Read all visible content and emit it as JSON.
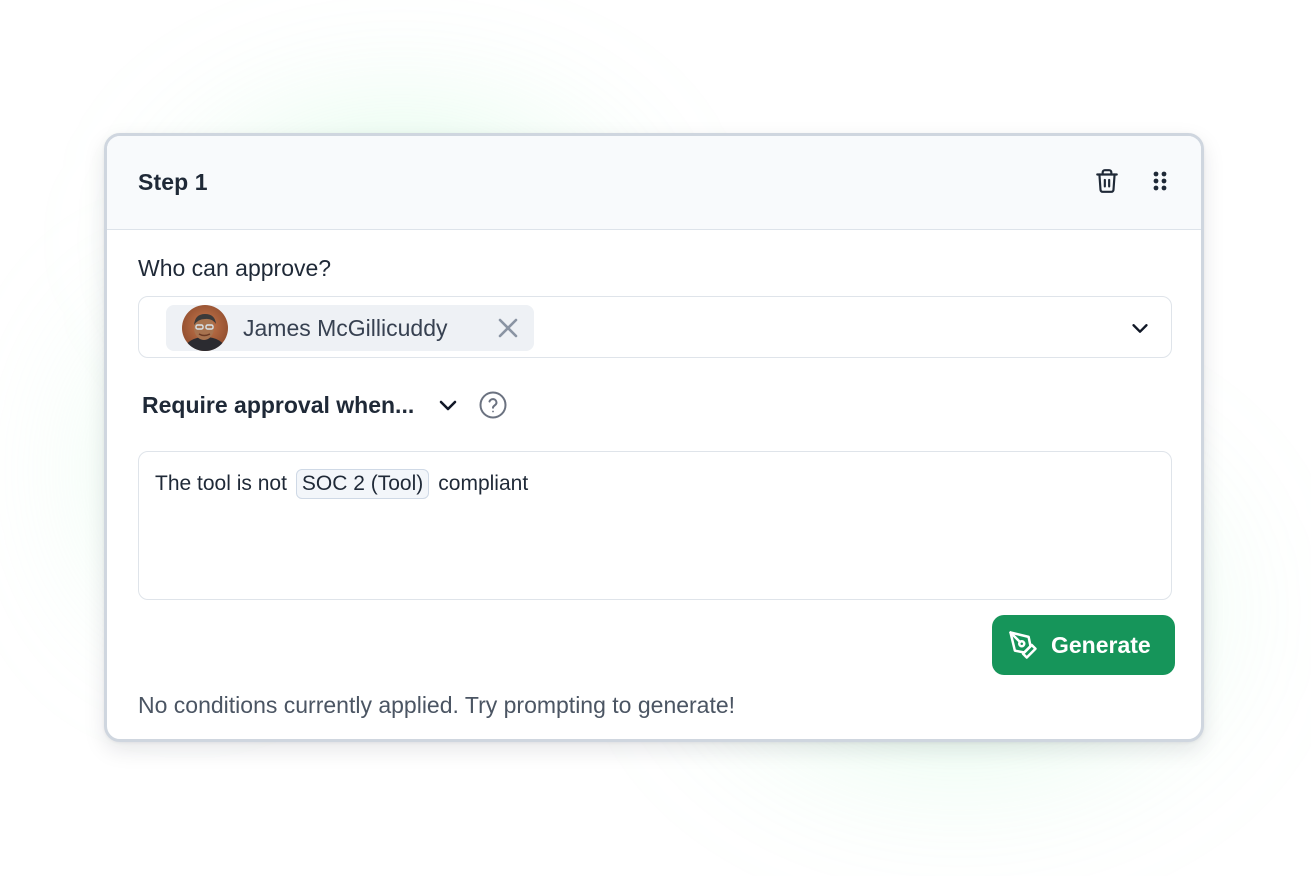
{
  "step": {
    "title": "Step 1"
  },
  "approvers": {
    "label": "Who can approve?",
    "selected": [
      {
        "name": "James McGillicuddy"
      }
    ]
  },
  "conditions": {
    "label": "Require approval when...",
    "prompt": {
      "prefix": "The tool is not",
      "token": "SOC 2 (Tool)",
      "suffix": "compliant"
    },
    "generate_label": "Generate",
    "status": "No conditions currently applied. Try prompting to generate!"
  },
  "colors": {
    "primary": "#16955a",
    "header_bg": "#f8fafc",
    "border": "#dfe4ea",
    "chip_bg": "#eef1f5"
  },
  "icons": {
    "delete": "trash-icon",
    "drag": "drag-handle-icon",
    "remove": "close-icon",
    "dropdown": "chevron-down-icon",
    "help": "help-circle-icon",
    "generate": "pen-tool-icon"
  }
}
